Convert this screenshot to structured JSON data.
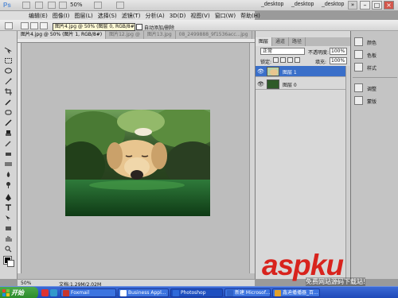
{
  "app": {
    "logo": "Ps",
    "zoom_mini": "50%",
    "workspaces": [
      "_desktop",
      "_desktop",
      "_desktop"
    ],
    "expand_glyph": "»"
  },
  "window_controls": {
    "minimize": "–",
    "maximize": "□",
    "close": "×"
  },
  "menu": [
    "编辑(E)",
    "图像(I)",
    "图层(L)",
    "选择(S)",
    "滤镜(T)",
    "分析(A)",
    "3D(D)",
    "视图(V)",
    "窗口(W)",
    "帮助(H)"
  ],
  "options_bar": {
    "tooltip": "图片4.jpg @ 50% (图层 0, RGB/8#)",
    "checkbox_label": "自动添加/删除"
  },
  "doc_tabs": [
    {
      "label": "图片4.jpg @ 50% (图片 1, RGB/8#)",
      "active": true
    },
    {
      "label": "图片12.jpg @",
      "active": false
    },
    {
      "label": "图片13.jpg",
      "active": false
    },
    {
      "label": "08_2499888_9f1536acc...jpg",
      "active": false
    }
  ],
  "status": {
    "zoom": "50%",
    "doc": "文档:1.29M/2.02M"
  },
  "layers": {
    "tabs": [
      "图层",
      "通道",
      "路径"
    ],
    "blend_mode": "正常",
    "opacity_label": "不透明度:",
    "opacity": "100%",
    "lock_label": "锁定:",
    "fill_label": "填充:",
    "fill": "100%",
    "items": [
      {
        "name": "图层 1",
        "selected": true,
        "eye": "👁"
      },
      {
        "name": "图层 0",
        "selected": false,
        "eye": "👁"
      }
    ]
  },
  "dock": {
    "group1": [
      "颜色",
      "色板",
      "样式"
    ],
    "group2": [
      "调整",
      "蒙版"
    ]
  },
  "watermark": {
    "main": "aspku",
    "sub": "免费网站源码下载站!"
  },
  "taskbar": {
    "start": "开始",
    "tasks": [
      {
        "label": "Foxmail",
        "color": "#c8352b"
      },
      {
        "label": "Business Appl...",
        "color": "#ffffff"
      },
      {
        "label": "Photoshop",
        "color": "#2f6ad9"
      },
      {
        "label": "新建 Microsof...",
        "color": "#2f62c8"
      },
      {
        "label": "鑫迪播播器_百...",
        "color": "#e2a12a"
      }
    ]
  }
}
